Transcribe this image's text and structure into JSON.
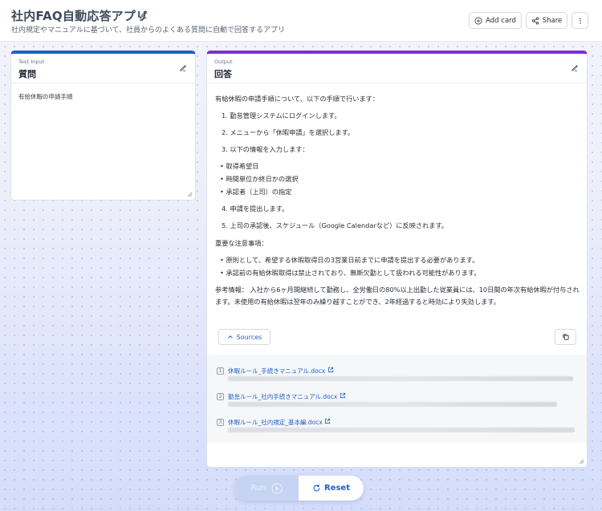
{
  "header": {
    "title": "社内FAQ自動応答アプリ",
    "subtitle": "社内規定やマニュアルに基づいて、社員からのよくある質問に自動で回答するアプリ",
    "add_card_label": "Add card",
    "share_label": "Share"
  },
  "input_card": {
    "kind": "Text Input",
    "title": "質問",
    "value": "有給休暇の申請手順"
  },
  "output_card": {
    "kind": "Output",
    "title": "回答",
    "intro": "有給休暇の申請手順について、以下の手順で行います：",
    "steps": [
      "1. 勤怠管理システムにログインします。",
      "2. メニューから「休暇申請」を選択します。",
      "3. 以下の情報を入力します："
    ],
    "sub_items": [
      "取得希望日",
      "時間単位か終日かの選択",
      "承認者（上司）の指定"
    ],
    "steps_after": [
      "4. 申請を提出します。",
      "5. 上司の承認後、スケジュール（Google Calendarなど）に反映されます。"
    ],
    "notes_heading": "重要な注意事項：",
    "notes": [
      "原則として、希望する休暇取得日の3営業日前までに申請を提出する必要があります。",
      "承認前の有給休暇取得は禁止されており、無断欠勤として扱われる可能性があります。"
    ],
    "reference": "参考情報： 入社から6ヶ月間継続して勤務し、全労働日の80%以上出勤した従業員には、10日間の年次有給休暇が付与されます。未使用の有給休暇は翌年のみ繰り越すことができ、2年経過すると時効により失効します。",
    "sources_label": "Sources",
    "sources": [
      {
        "num": "1",
        "name": "休暇ルール_手続きマニュアル.docx"
      },
      {
        "num": "2",
        "name": "勤怠ルール_社内手続きマニュアル.docx"
      },
      {
        "num": "3",
        "name": "休暇ルール_社内規定_基本編.docx"
      }
    ]
  },
  "actions": {
    "run_label": "Run",
    "reset_label": "Reset"
  },
  "colors": {
    "accent_blue": "#1f5fce",
    "accent_purple": "#7a2fd1"
  }
}
